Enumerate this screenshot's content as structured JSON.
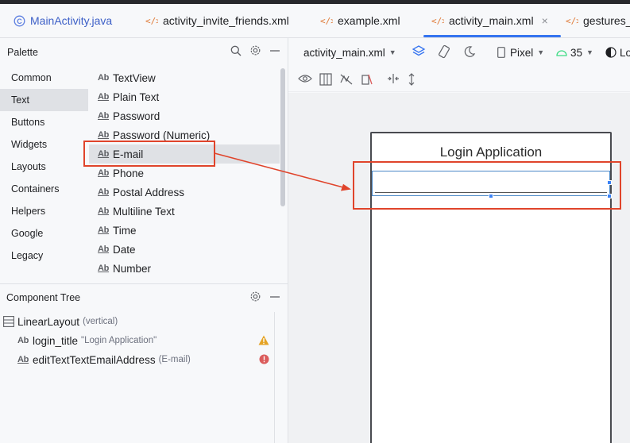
{
  "tabs": [
    {
      "label": "MainActivity.java",
      "icon": "java-class-icon",
      "active": false
    },
    {
      "label": "activity_invite_friends.xml",
      "icon": "xml-file-icon",
      "active": false
    },
    {
      "label": "example.xml",
      "icon": "xml-file-icon",
      "active": false
    },
    {
      "label": "activity_main.xml",
      "icon": "xml-file-icon",
      "active": true,
      "close": "×"
    },
    {
      "label": "gestures_",
      "icon": "xml-file-icon",
      "active": false
    }
  ],
  "palette": {
    "title": "Palette",
    "categories": [
      "Common",
      "Text",
      "Buttons",
      "Widgets",
      "Layouts",
      "Containers",
      "Helpers",
      "Google",
      "Legacy"
    ],
    "selected_category": "Text",
    "items": [
      "TextView",
      "Plain Text",
      "Password",
      "Password (Numeric)",
      "E-mail",
      "Phone",
      "Postal Address",
      "Multiline Text",
      "Time",
      "Date",
      "Number"
    ],
    "selected_item": "E-mail",
    "ab_glyph": "Ab"
  },
  "component_tree": {
    "title": "Component Tree",
    "root": {
      "label": "LinearLayout",
      "sub": "(vertical)"
    },
    "children": [
      {
        "label": "login_title",
        "sub": "\"Login Application\"",
        "status": "warning"
      },
      {
        "label": "editTextTextEmailAddress",
        "sub": "(E-mail)",
        "status": "error"
      }
    ]
  },
  "design_toolbar": {
    "file": "activity_main.xml",
    "device": "Pixel",
    "api": "35",
    "locale": "Lo"
  },
  "preview": {
    "title_text": "Login Application"
  },
  "colors": {
    "accent": "#3574f0",
    "annotation": "#e0442b",
    "warning": "#e5a325",
    "error": "#db5c5c"
  }
}
